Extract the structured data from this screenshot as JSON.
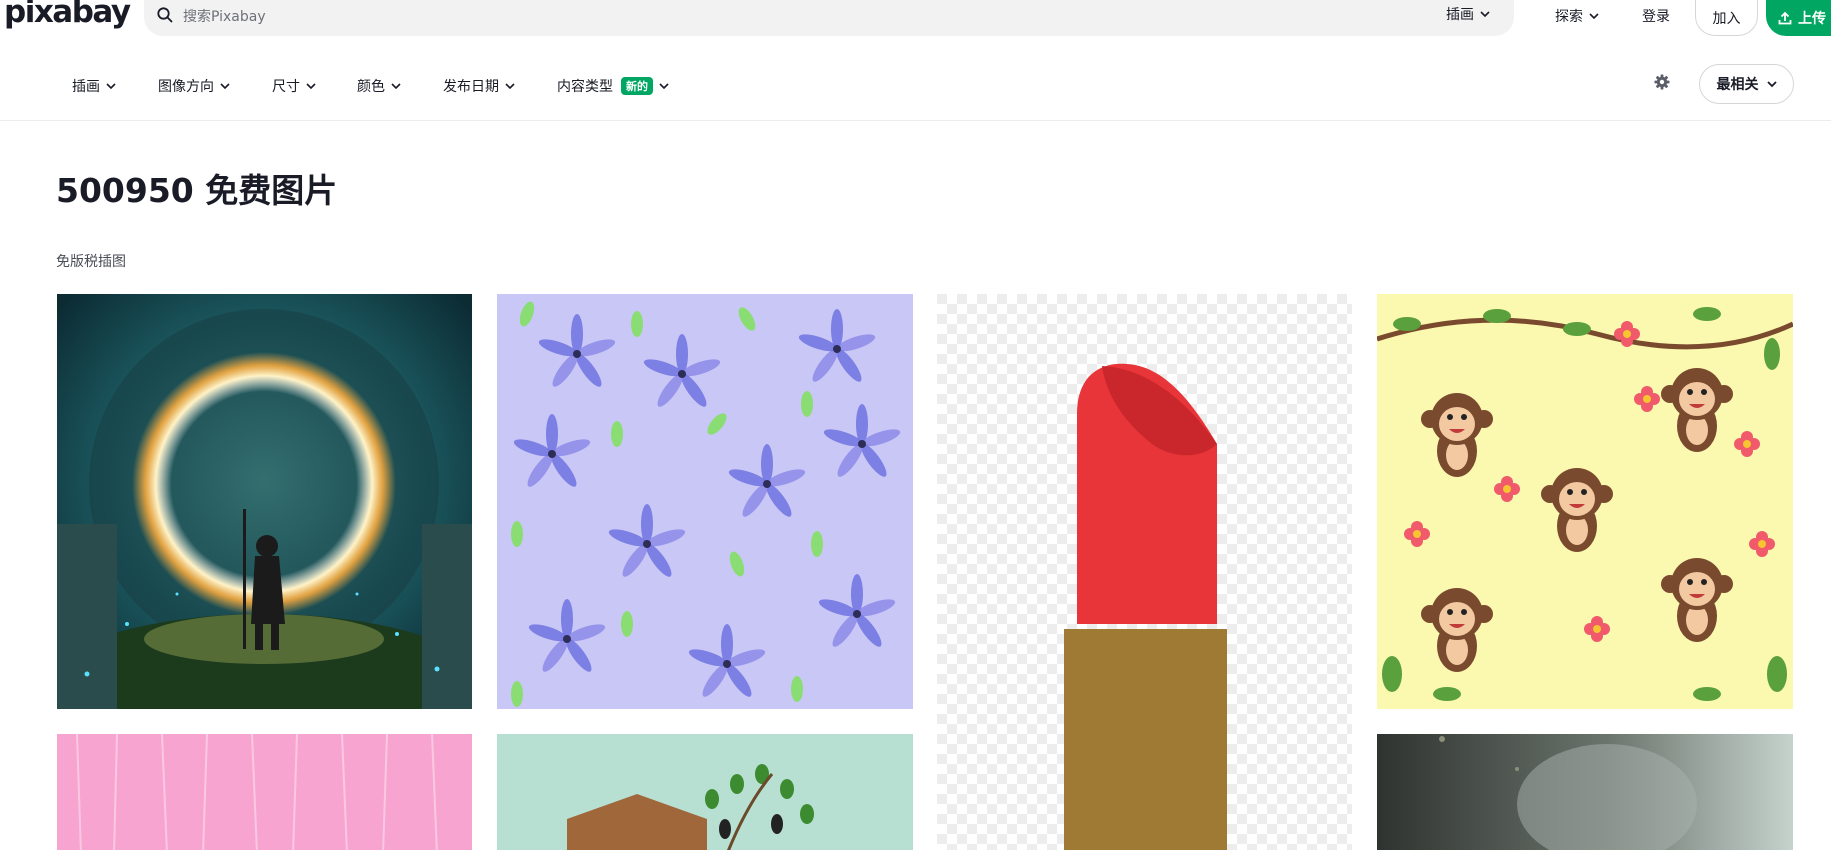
{
  "brand": {
    "logo_text": "pixabay",
    "accent_color": "#00a662"
  },
  "search": {
    "placeholder": "搜索Pixabay",
    "type_label": "插画",
    "icon": "search-icon"
  },
  "nav": {
    "explore": "探索",
    "login": "登录",
    "join": "加入",
    "upload": "上传"
  },
  "filters": {
    "items": [
      {
        "label": "插画"
      },
      {
        "label": "图像方向"
      },
      {
        "label": "尺寸"
      },
      {
        "label": "颜色"
      },
      {
        "label": "发布日期"
      },
      {
        "label": "内容类型",
        "badge": "新的"
      }
    ],
    "sort_label": "最相关",
    "settings_icon": "gear-icon"
  },
  "heading": {
    "title": "500950 免费图片",
    "subtitle": "免版税插图"
  },
  "images": [
    {
      "name": "forest-portal-illustration"
    },
    {
      "name": "blue-flower-pattern"
    },
    {
      "name": "red-lipstick"
    },
    {
      "name": "monkey-pattern"
    },
    {
      "name": "pink-wood-texture"
    },
    {
      "name": "house-plant-illustration"
    },
    {
      "name": "smoke-photo"
    }
  ]
}
